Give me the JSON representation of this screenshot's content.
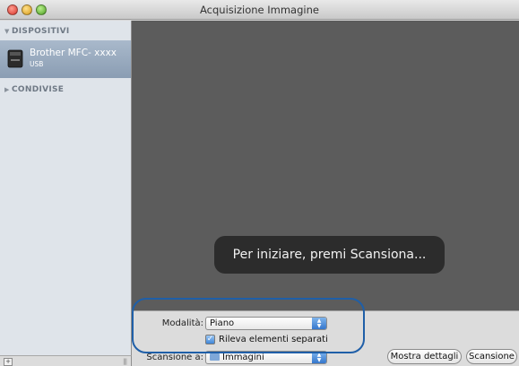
{
  "window": {
    "title": "Acquisizione Immagine"
  },
  "sidebar": {
    "devices_header": "DISPOSITIVI",
    "device": {
      "name": "Brother MFC- xxxx",
      "connection": "USB",
      "icon": "scanner-icon"
    },
    "shared_header": "CONDIVISE"
  },
  "content": {
    "hint": "Per iniziare, premi Scansiona..."
  },
  "controls": {
    "mode_label": "Modalità:",
    "mode_value": "Piano",
    "detect_label": "Rileva elementi separati",
    "detect_checked": true,
    "scan_to_label": "Scansione a:",
    "scan_to_value": "Immagini",
    "show_details_label": "Mostra dettagli",
    "scan_label": "Scansione"
  },
  "colors": {
    "selection": "#95a8be",
    "content_bg": "#5c5c5c",
    "accent_blue": "#3577cc",
    "callout": "#1f5fa8"
  }
}
